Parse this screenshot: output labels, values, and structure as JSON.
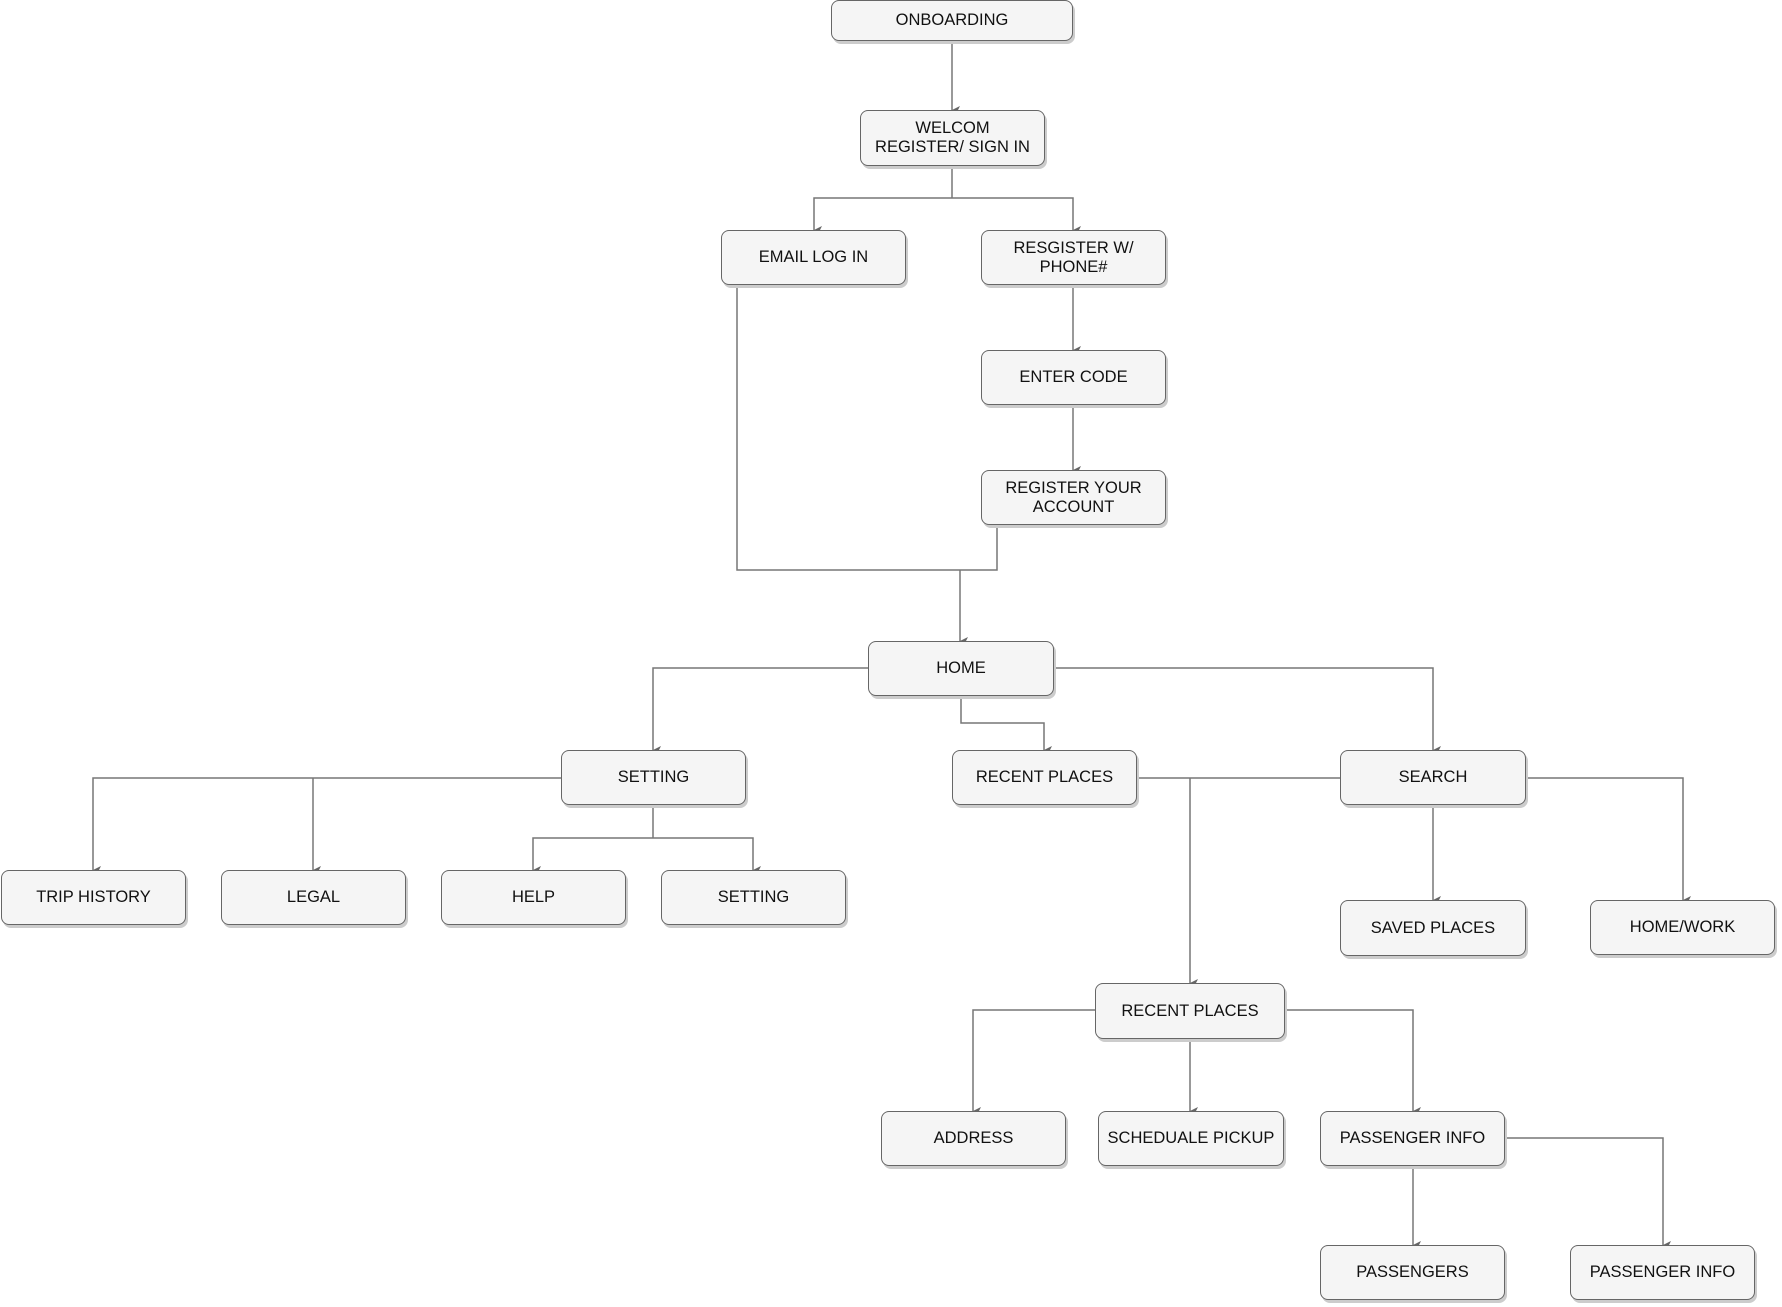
{
  "diagram": {
    "type": "flowchart",
    "title": "",
    "colors": {
      "node_fill": "#f5f5f5",
      "node_border": "#666666",
      "edge": "#777777",
      "text": "#111111"
    },
    "nodes": [
      {
        "id": "onboarding",
        "label": "ONBOARDING"
      },
      {
        "id": "welcome",
        "label": "WELCOM\nREGISTER/ SIGN IN"
      },
      {
        "id": "email_login",
        "label": "EMAIL LOG IN"
      },
      {
        "id": "register_phone",
        "label": "RESGISTER W/\nPHONE#"
      },
      {
        "id": "enter_code",
        "label": "ENTER CODE"
      },
      {
        "id": "register_account",
        "label": "REGISTER YOUR\nACCOUNT"
      },
      {
        "id": "home",
        "label": "HOME"
      },
      {
        "id": "setting",
        "label": "SETTING"
      },
      {
        "id": "recent_places",
        "label": "RECENT PLACES"
      },
      {
        "id": "search",
        "label": "SEARCH"
      },
      {
        "id": "trip_history",
        "label": "TRIP HISTORY"
      },
      {
        "id": "legal",
        "label": "LEGAL"
      },
      {
        "id": "help",
        "label": "HELP"
      },
      {
        "id": "setting_sub",
        "label": "SETTING"
      },
      {
        "id": "saved_places",
        "label": "SAVED PLACES"
      },
      {
        "id": "home_work",
        "label": "HOME/WORK"
      },
      {
        "id": "recent_places_2",
        "label": "RECENT PLACES"
      },
      {
        "id": "address",
        "label": "ADDRESS"
      },
      {
        "id": "schedule_pickup",
        "label": "SCHEDUALE PICKUP"
      },
      {
        "id": "passenger_info",
        "label": "PASSENGER INFO"
      },
      {
        "id": "passengers",
        "label": "PASSENGERS"
      },
      {
        "id": "passenger_info_2",
        "label": "PASSENGER INFO"
      }
    ],
    "edges": [
      {
        "from": "onboarding",
        "to": "welcome"
      },
      {
        "from": "welcome",
        "to": "email_login"
      },
      {
        "from": "welcome",
        "to": "register_phone"
      },
      {
        "from": "register_phone",
        "to": "enter_code"
      },
      {
        "from": "enter_code",
        "to": "register_account"
      },
      {
        "from": "email_login",
        "to": "home"
      },
      {
        "from": "register_account",
        "to": "home"
      },
      {
        "from": "home",
        "to": "setting"
      },
      {
        "from": "home",
        "to": "recent_places"
      },
      {
        "from": "home",
        "to": "search"
      },
      {
        "from": "setting",
        "to": "trip_history"
      },
      {
        "from": "setting",
        "to": "legal"
      },
      {
        "from": "setting",
        "to": "help"
      },
      {
        "from": "setting",
        "to": "setting_sub"
      },
      {
        "from": "search",
        "to": "saved_places"
      },
      {
        "from": "search",
        "to": "home_work"
      },
      {
        "from": "recent_places",
        "to": "recent_places_2"
      },
      {
        "from": "search",
        "to": "recent_places_2"
      },
      {
        "from": "recent_places_2",
        "to": "address"
      },
      {
        "from": "recent_places_2",
        "to": "schedule_pickup"
      },
      {
        "from": "recent_places_2",
        "to": "passenger_info"
      },
      {
        "from": "passenger_info",
        "to": "passengers"
      },
      {
        "from": "passenger_info",
        "to": "passenger_info_2"
      }
    ]
  }
}
